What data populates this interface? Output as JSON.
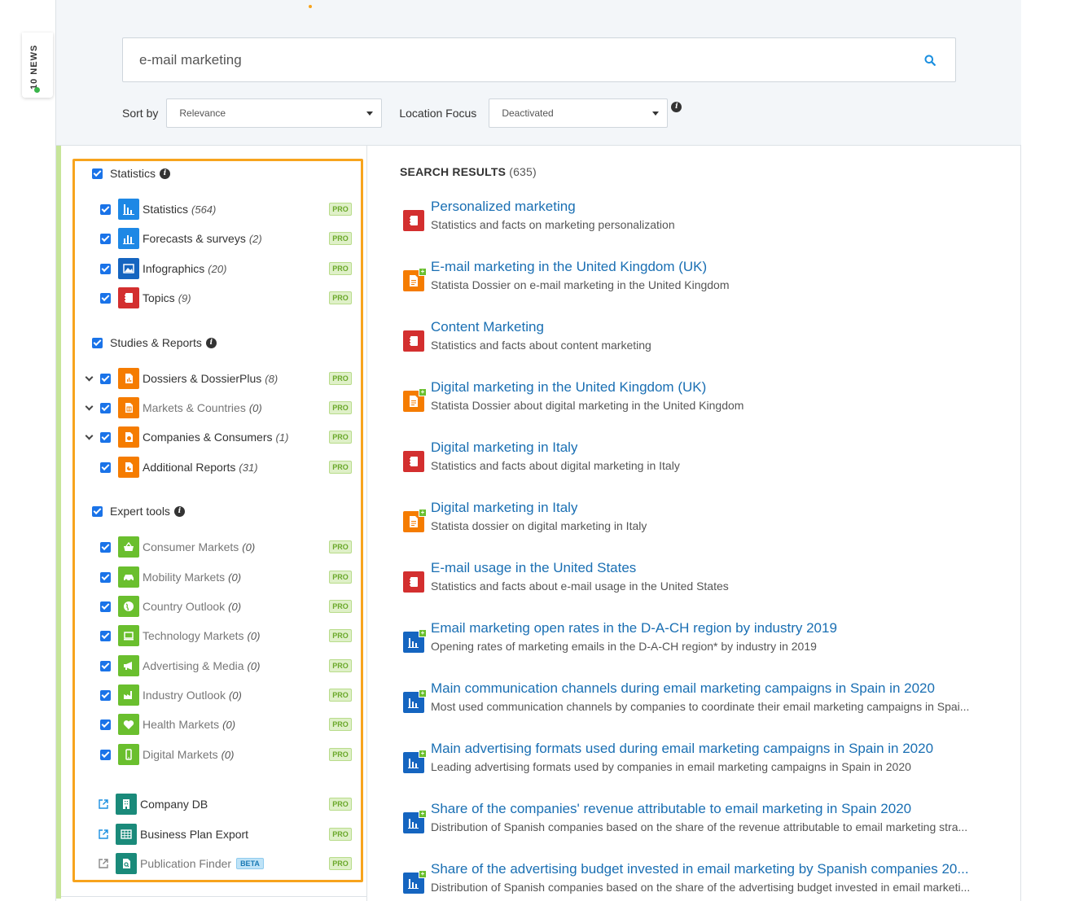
{
  "news_tab": {
    "label": "10 NEWS"
  },
  "search": {
    "value": "e-mail marketing",
    "placeholder": ""
  },
  "sort": {
    "label": "Sort by",
    "value": "Relevance"
  },
  "location": {
    "label": "Location Focus",
    "value": "Deactivated"
  },
  "filters": {
    "sections": [
      {
        "label": "Statistics"
      },
      {
        "label": "Studies & Reports"
      },
      {
        "label": "Expert tools"
      }
    ],
    "statistics": [
      {
        "label": "Statistics",
        "count": "(564)"
      },
      {
        "label": "Forecasts & surveys",
        "count": "(2)"
      },
      {
        "label": "Infographics",
        "count": "(20)"
      },
      {
        "label": "Topics",
        "count": "(9)"
      }
    ],
    "studies": [
      {
        "label": "Dossiers & DossierPlus",
        "count": "(8)"
      },
      {
        "label": "Markets & Countries",
        "count": "(0)"
      },
      {
        "label": "Companies & Consumers",
        "count": "(1)"
      },
      {
        "label": "Additional Reports",
        "count": "(31)"
      }
    ],
    "expert": [
      {
        "label": "Consumer Markets",
        "count": "(0)"
      },
      {
        "label": "Mobility Markets",
        "count": "(0)"
      },
      {
        "label": "Country Outlook",
        "count": "(0)"
      },
      {
        "label": "Technology Markets",
        "count": "(0)"
      },
      {
        "label": "Advertising & Media",
        "count": "(0)"
      },
      {
        "label": "Industry Outlook",
        "count": "(0)"
      },
      {
        "label": "Health Markets",
        "count": "(0)"
      },
      {
        "label": "Digital Markets",
        "count": "(0)"
      }
    ],
    "links": [
      {
        "label": "Company DB"
      },
      {
        "label": "Business Plan Export"
      },
      {
        "label": "Publication Finder",
        "badge": "BETA"
      }
    ],
    "pro_label": "PRO"
  },
  "results": {
    "heading": "SEARCH RESULTS",
    "count": "(635)",
    "items": [
      {
        "title": "Personalized marketing",
        "desc": "Statistics and facts on marketing personalization"
      },
      {
        "title": "E-mail marketing in the United Kingdom (UK)",
        "desc": "Statista Dossier on e-mail marketing in the United Kingdom"
      },
      {
        "title": "Content Marketing",
        "desc": "Statistics and facts about content marketing"
      },
      {
        "title": "Digital marketing in the United Kingdom (UK)",
        "desc": "Statista Dossier about digital marketing in the United Kingdom"
      },
      {
        "title": "Digital marketing in Italy",
        "desc": "Statistics and facts about digital marketing in Italy"
      },
      {
        "title": "Digital marketing in Italy",
        "desc": "Statista dossier on digital marketing in Italy"
      },
      {
        "title": "E-mail usage in the United States",
        "desc": "Statistics and facts about e-mail usage in the United States"
      },
      {
        "title": "Email marketing open rates in the D-A-CH region by industry 2019",
        "desc": "Opening rates of marketing emails in the D-A-CH region* by industry in 2019"
      },
      {
        "title": "Main communication channels during email marketing campaigns in Spain in 2020",
        "desc": "Most used communication channels by companies to coordinate their email marketing campaigns in Spai..."
      },
      {
        "title": "Main advertising formats used during email marketing campaigns in Spain in 2020",
        "desc": "Leading advertising formats used by companies in email marketing campaigns in Spain in 2020"
      },
      {
        "title": "Share of the companies' revenue attributable to email marketing in Spain 2020",
        "desc": "Distribution of Spanish companies based on the share of the revenue attributable to email marketing stra..."
      },
      {
        "title": "Share of the advertising budget invested in email marketing by Spanish companies 20...",
        "desc": "Distribution of Spanish companies based on the share of the advertising budget invested in email marketi..."
      }
    ]
  }
}
